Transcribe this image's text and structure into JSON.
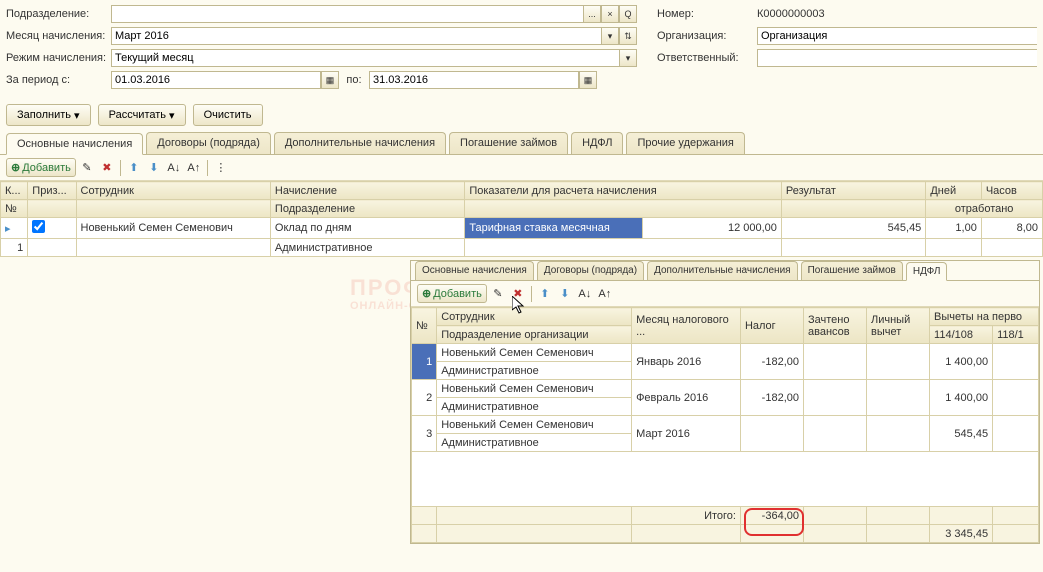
{
  "header": {
    "labels": {
      "podrazdelenie": "Подразделение:",
      "mesyac": "Месяц начисления:",
      "rezhim": "Режим начисления:",
      "period_s": "За период с:",
      "po": "по:",
      "nomer": "Номер:",
      "organizaciya": "Организация:",
      "otvetstvennyy": "Ответственный:"
    },
    "values": {
      "podrazdelenie": "",
      "mesyac": "Март 2016",
      "rezhim": "Текущий месяц",
      "period_s": "01.03.2016",
      "period_po": "31.03.2016",
      "nomer": "К0000000003",
      "organizaciya": "Организация",
      "otvetstvennyy": ""
    }
  },
  "toolbar": {
    "zapolnit": "Заполнить",
    "rasschitat": "Рассчитать",
    "ochistit": "Очистить"
  },
  "tabs_main": [
    "Основные начисления",
    "Договоры (подряда)",
    "Дополнительные начисления",
    "Погашение займов",
    "НДФЛ",
    "Прочие удержания"
  ],
  "subtoolbar": {
    "dobavit": "Добавить"
  },
  "grid1": {
    "headers": {
      "k": "К...",
      "priz": "Приз...",
      "sotrudnik": "Сотрудник",
      "nachislenie": "Начисление",
      "pokazateli": "Показатели для расчета начисления",
      "rezultat": "Результат",
      "dney": "Дней",
      "chasov": "Часов",
      "no": "№",
      "podrazdelenie": "Подразделение",
      "otrabotano": "отработано"
    },
    "row": {
      "no": "1",
      "sotrudnik": "Новенький Семен Семенович",
      "nachislenie": "Оклад по дням",
      "podrazdelenie": "Административное",
      "pokazatel_label": "Тарифная ставка месячная",
      "pokazatel_value": "12 000,00",
      "rezultat": "545,45",
      "dney": "1,00",
      "chasov": "8,00"
    }
  },
  "nested": {
    "tabs": [
      "Основные начисления",
      "Договоры (подряда)",
      "Дополнительные начисления",
      "Погашение займов",
      "НДФЛ"
    ],
    "active_tab": "НДФЛ",
    "headers": {
      "no": "№",
      "sotrudnik": "Сотрудник",
      "mesyac_nalog": "Месяц налогового ...",
      "nalog": "Налог",
      "zachteno": "Зачтено авансов",
      "lichnyy": "Личный вычет",
      "vychety": "Вычеты на перво",
      "podrazdelenie_org": "Подразделение организации",
      "col_114": "114/108",
      "col_118": "118/1"
    },
    "rows": [
      {
        "no": "1",
        "sotrudnik": "Новенький Семен Семенович",
        "mesyac": "Январь 2016",
        "nalog": "-182,00",
        "zachteno": "",
        "lichnyy": "",
        "vychet": "1 400,00",
        "podrazdelenie": "Административное"
      },
      {
        "no": "2",
        "sotrudnik": "Новенький Семен Семенович",
        "mesyac": "Февраль 2016",
        "nalog": "-182,00",
        "zachteno": "",
        "lichnyy": "",
        "vychet": "1 400,00",
        "podrazdelenie": "Административное"
      },
      {
        "no": "3",
        "sotrudnik": "Новенький Семен Семенович",
        "mesyac": "Март 2016",
        "nalog": "",
        "zachteno": "",
        "lichnyy": "",
        "vychet": "545,45",
        "podrazdelenie": "Административное"
      }
    ],
    "footer": {
      "itogo_label": "Итого:",
      "itogo_value": "-364,00",
      "vychet_total": "3 345,45"
    }
  },
  "icons": {
    "dots": "...",
    "x": "×",
    "search": "🔍",
    "dropdown": "▼",
    "dropdown2": "▾",
    "cal": "📅",
    "plus": "⊕",
    "updown": "⇅"
  }
}
